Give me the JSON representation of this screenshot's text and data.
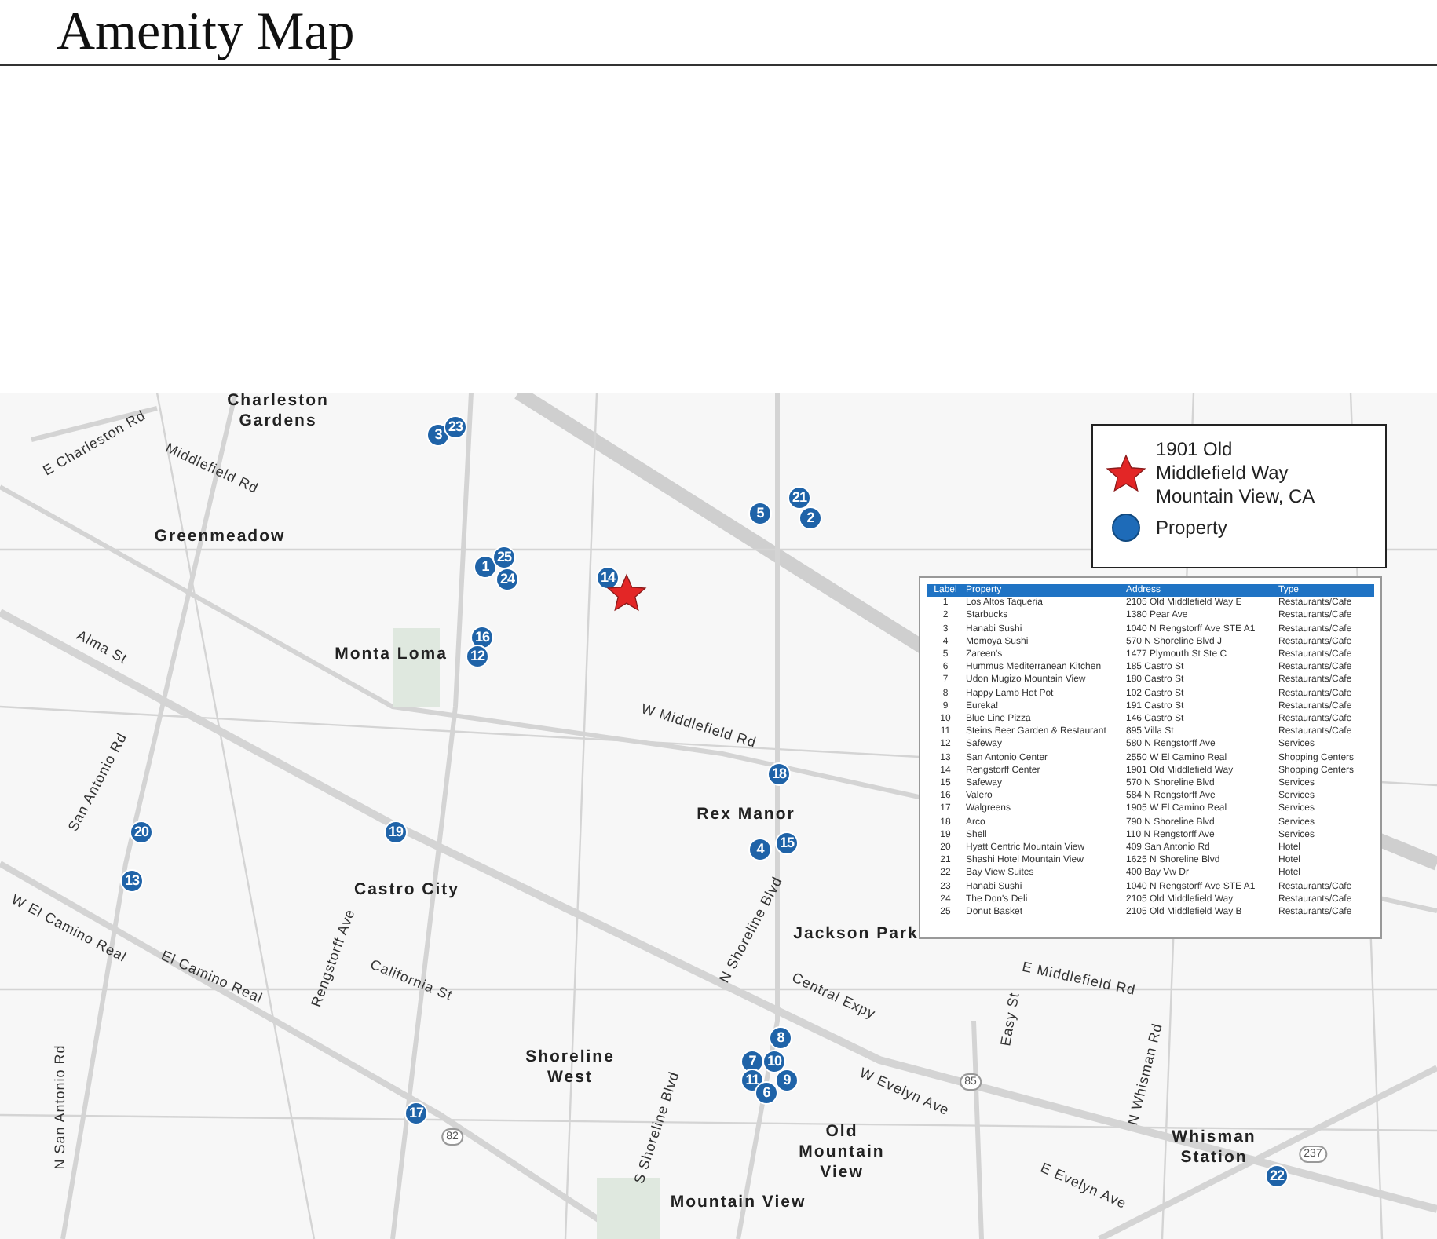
{
  "title": "Amenity Map",
  "map": {
    "places": [
      "Charleston Gardens",
      "Greenmeadow",
      "Monta Loma",
      "Rex Manor",
      "Castro City",
      "Jackson Park",
      "Shoreline West",
      "Old Mountain View",
      "Mountain View",
      "Whisman Station"
    ],
    "streets": [
      "E Charleston Rd",
      "Middlefield Rd",
      "Alma St",
      "W Middlefield Rd",
      "San Antonio Rd",
      "W El Camino Real",
      "El Camino Real",
      "Rengstorff Ave",
      "California St",
      "Central Expy",
      "N Shoreline Blvd",
      "S Shoreline Blvd",
      "N San Antonio Rd",
      "W Evelyn Ave",
      "E Evelyn Ave",
      "E Middlefield Rd",
      "Easy St",
      "N Whisman Rd"
    ],
    "shields": [
      "82",
      "85",
      "237"
    ],
    "subject_marker": {
      "label": "14"
    },
    "markers": [
      {
        "label": "3"
      },
      {
        "label": "23"
      },
      {
        "label": "1"
      },
      {
        "label": "25"
      },
      {
        "label": "24"
      },
      {
        "label": "16"
      },
      {
        "label": "12"
      },
      {
        "label": "5"
      },
      {
        "label": "21"
      },
      {
        "label": "2"
      },
      {
        "label": "18"
      },
      {
        "label": "4"
      },
      {
        "label": "15"
      },
      {
        "label": "20"
      },
      {
        "label": "13"
      },
      {
        "label": "19"
      },
      {
        "label": "17"
      },
      {
        "label": "8"
      },
      {
        "label": "7"
      },
      {
        "label": "10"
      },
      {
        "label": "11"
      },
      {
        "label": "9"
      },
      {
        "label": "6"
      },
      {
        "label": "22"
      }
    ]
  },
  "legend": {
    "subject": "1901 Old Middlefield Way Mountain View, CA",
    "property": "Property"
  },
  "table": {
    "columns": [
      "Label",
      "Property",
      "Address",
      "Type"
    ],
    "rows": [
      [
        "1",
        "Los Altos Taqueria",
        "2105 Old Middlefield Way E",
        "Restaurants/Cafe"
      ],
      [
        "2",
        "Starbucks",
        "1380 Pear Ave",
        "Restaurants/Cafe"
      ],
      [
        "3",
        "Hanabi Sushi",
        "1040 N Rengstorff Ave STE A1",
        "Restaurants/Cafe"
      ],
      [
        "4",
        "Momoya Sushi",
        "570 N Shoreline Blvd J",
        "Restaurants/Cafe"
      ],
      [
        "5",
        "Zareen's",
        "1477 Plymouth St Ste C",
        "Restaurants/Cafe"
      ],
      [
        "6",
        "Hummus Mediterranean Kitchen",
        "185 Castro St",
        "Restaurants/Cafe"
      ],
      [
        "7",
        "Udon Mugizo Mountain View",
        "180 Castro St",
        "Restaurants/Cafe"
      ],
      [
        "8",
        "Happy Lamb Hot Pot",
        "102 Castro St",
        "Restaurants/Cafe"
      ],
      [
        "9",
        "Eureka!",
        "191 Castro St",
        "Restaurants/Cafe"
      ],
      [
        "10",
        "Blue Line Pizza",
        "146 Castro St",
        "Restaurants/Cafe"
      ],
      [
        "11",
        "Steins Beer Garden & Restaurant",
        "895 Villa St",
        "Restaurants/Cafe"
      ],
      [
        "12",
        "Safeway",
        "580 N Rengstorff Ave",
        "Services"
      ],
      [
        "13",
        "San Antonio Center",
        "2550 W El Camino Real",
        "Shopping Centers"
      ],
      [
        "14",
        "Rengstorff Center",
        "1901 Old Middlefield Way",
        "Shopping Centers"
      ],
      [
        "15",
        "Safeway",
        "570 N Shoreline Blvd",
        "Services"
      ],
      [
        "16",
        "Valero",
        "584 N Rengstorff Ave",
        "Services"
      ],
      [
        "17",
        "Walgreens",
        "1905 W El Camino Real",
        "Services"
      ],
      [
        "18",
        "Arco",
        "790 N Shoreline Blvd",
        "Services"
      ],
      [
        "19",
        "Shell",
        "110 N Rengstorff Ave",
        "Services"
      ],
      [
        "20",
        "Hyatt Centric Mountain View",
        "409 San Antonio Rd",
        "Hotel"
      ],
      [
        "21",
        "Shashi Hotel Mountain View",
        "1625 N Shoreline Blvd",
        "Hotel"
      ],
      [
        "22",
        "Bay View Suites",
        "400 Bay Vw Dr",
        "Hotel"
      ],
      [
        "23",
        "Hanabi Sushi",
        "1040 N Rengstorff Ave STE A1",
        "Restaurants/Cafe"
      ],
      [
        "24",
        "The Don's Deli",
        "2105 Old Middlefield Way",
        "Restaurants/Cafe"
      ],
      [
        "25",
        "Donut Basket",
        "2105 Old Middlefield Way B",
        "Restaurants/Cafe"
      ]
    ]
  }
}
